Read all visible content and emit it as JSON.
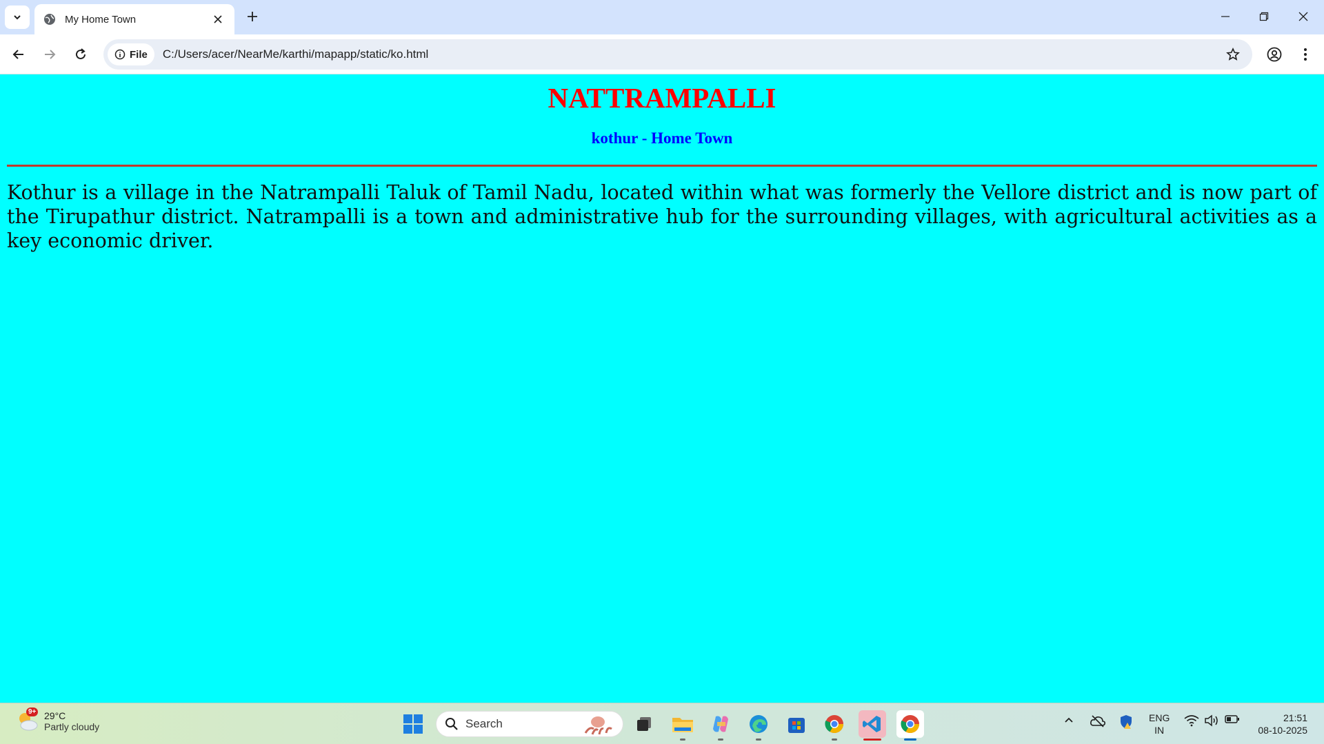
{
  "browser": {
    "tab_title": "My Home Town",
    "address_chip": "File",
    "url": "C:/Users/acer/NearMe/karthi/mapapp/static/ko.html"
  },
  "page": {
    "heading": "NATTRAMPALLI",
    "subheading": "kothur - Home Town",
    "paragraph": "Kothur is a village in the Natrampalli Taluk of Tamil Nadu, located within what was formerly the Vellore district and is now part of the Tirupathur district. Natrampalli is a town and administrative hub for the surrounding villages, with agricultural activities as a key economic driver.",
    "background_color": "#00ffff",
    "heading_color": "#ff0000",
    "subheading_color": "#0000ff"
  },
  "taskbar": {
    "weather_badge": "9+",
    "temperature": "29°C",
    "condition": "Partly cloudy",
    "search_label": "Search",
    "language_primary": "ENG",
    "language_secondary": "IN",
    "time": "21:51",
    "date": "08-10-2025",
    "pinned_apps": [
      "start-icon",
      "task-view-icon",
      "file-explorer-icon",
      "copilot-icon",
      "edge-icon",
      "microsoft-store-icon",
      "chrome-icon",
      "vscode-icon",
      "chrome-icon"
    ]
  }
}
